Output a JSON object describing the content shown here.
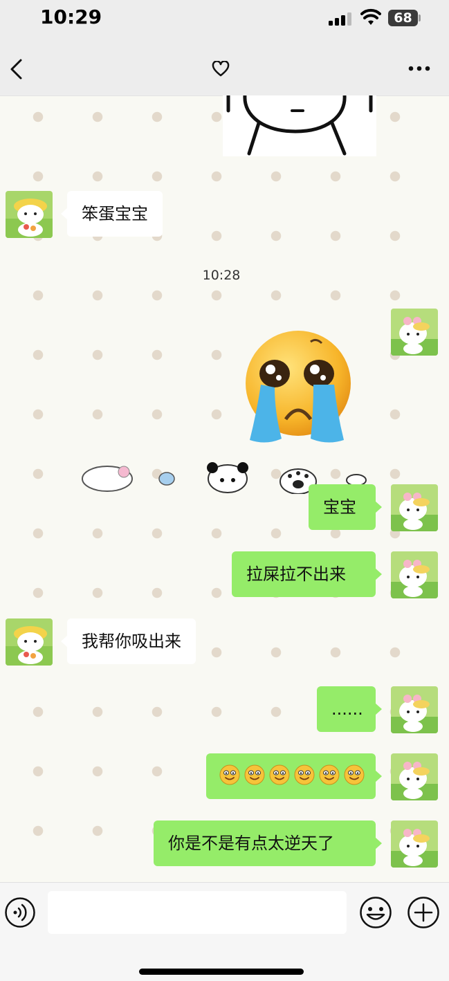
{
  "status_bar": {
    "time": "10:29",
    "battery": "68"
  },
  "messages": [
    {
      "side": "in",
      "text": "笨蛋宝宝"
    },
    {
      "side": "out",
      "text": "宝宝"
    },
    {
      "side": "out",
      "text": "拉屎拉不出来"
    },
    {
      "side": "in",
      "text": "我帮你吸出来"
    },
    {
      "side": "out",
      "text": "......"
    },
    {
      "side": "out",
      "text": "smile-emoji x6"
    },
    {
      "side": "out",
      "text": "你是不是有点太逆天了"
    }
  ],
  "timestamp": "10:28",
  "emoji_count": 6,
  "icons": [
    "back-icon",
    "heart-icon",
    "more-icon",
    "voice-icon",
    "emoji-icon",
    "plus-icon"
  ]
}
